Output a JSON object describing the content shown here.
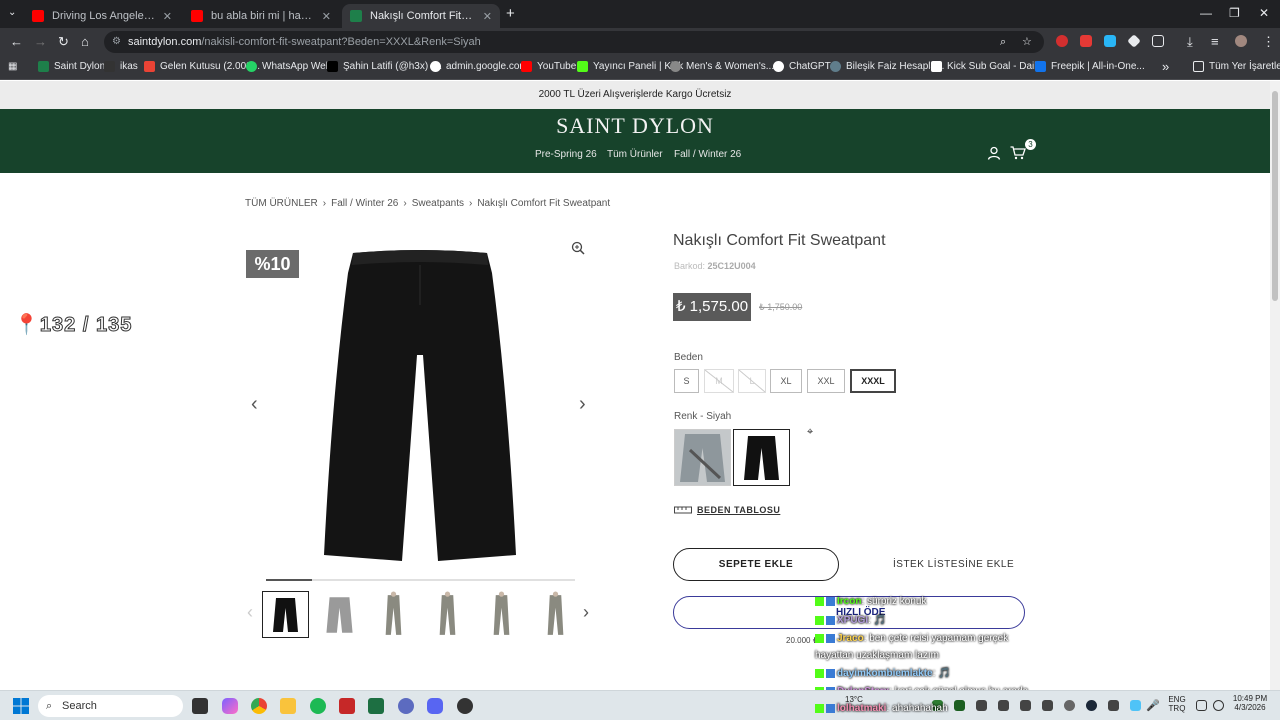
{
  "browser": {
    "tabs": [
      {
        "title": "Driving Los Angeles: Mulholland",
        "favicon_color": "#ff0000"
      },
      {
        "title": "bu abla biri mi | hakkımda mera",
        "favicon_color": "#ff0000"
      },
      {
        "title": "Nakışlı Comfort Fit Sweatpant",
        "favicon_color": "#1e7f4a"
      }
    ],
    "new_tab": "+",
    "url_host": "saintdylon.com",
    "url_path": "/nakisli-comfort-fit-sweatpant?Beden=XXXL&Renk=Siyah",
    "bookmarks": [
      "Saint Dylon",
      "ikas",
      "Gelen Kutusu (2.008...",
      "WhatsApp Web",
      "Şahin Latifi (@h3x) /...",
      "admin.google.com",
      "YouTube",
      "Yayıncı Paneli | Kick",
      "Men's & Women's...",
      "ChatGPT",
      "Bileşik Faiz Hesapla...",
      "Kick Sub Goal - Dail...",
      "Freepik | All-in-One..."
    ],
    "bookmarks_more": "»",
    "all_bookmarks": "Tüm Yer İşaretleri"
  },
  "site": {
    "promo": "2000 TL Üzeri Alışverişlerde Kargo Ücretsiz",
    "logo": "SAINT DYLON",
    "nav": [
      "Pre-Spring 26",
      "Tüm Ürünler",
      "Fall / Winter 26"
    ],
    "cart_count": "3"
  },
  "breadcrumb": [
    "TÜM ÜRÜNLER",
    "Fall / Winter 26",
    "Sweatpants",
    "Nakışlı Comfort Fit Sweatpant"
  ],
  "gallery": {
    "discount": "%10",
    "progress": 0.15,
    "thumbs": [
      {
        "color": "#111111"
      },
      {
        "color": "#9a9a9a"
      },
      {
        "color": "#8a8a80"
      },
      {
        "color": "#8a8a80"
      },
      {
        "color": "#8a8a80"
      },
      {
        "color": "#8a8a80"
      }
    ]
  },
  "overlay_counter": "132 / 135",
  "product": {
    "title": "Nakışlı Comfort Fit Sweatpant",
    "barcode_label": "Barkod:",
    "barcode": "25C12U004",
    "price": "₺ 1,575.00",
    "old_price": "₺ 1,750.00",
    "size_label": "Beden",
    "sizes": [
      {
        "label": "S",
        "state": "available"
      },
      {
        "label": "M",
        "state": "unavailable"
      },
      {
        "label": "L",
        "state": "unavailable"
      },
      {
        "label": "XL",
        "state": "available"
      },
      {
        "label": "XXL",
        "state": "available"
      },
      {
        "label": "XXXL",
        "state": "selected"
      }
    ],
    "color_label": "Renk - Siyah",
    "colors": [
      {
        "name": "gri",
        "hex": "#9aa0a3"
      },
      {
        "name": "siyah",
        "hex": "#111111"
      }
    ],
    "size_chart": "BEDEN TABLOSU",
    "add_to_cart": "SEPETE EKLE",
    "wishlist": "İSTEK LİSTESİNE EKLE",
    "fast_buy": "HIZLI ÖDE",
    "install_note": "20.000 ₺"
  },
  "chat": [
    {
      "user": "Ircon",
      "text": ": sürpriz konuk"
    },
    {
      "user": "XPUGI",
      "text": ": 🎵"
    },
    {
      "user": "Jraco",
      "text": ": ben çete reisi yapamam gerçek"
    },
    {
      "user": "",
      "text": "hayattan uzaklaşmam lazım"
    },
    {
      "user": "dayimkombiemlakte",
      "text": ": 🎵"
    },
    {
      "user": "DylanStarx",
      "text": ": kart çok güzel olmuş bu arada"
    },
    {
      "user": "lolhatmaki",
      "text": ": ahahahahah"
    }
  ],
  "taskbar": {
    "search": "Search",
    "weather": "13°C",
    "lang_top": "ENG",
    "lang_bottom": "TRQ",
    "time": "10:49 PM",
    "date": "4/3/2026"
  }
}
